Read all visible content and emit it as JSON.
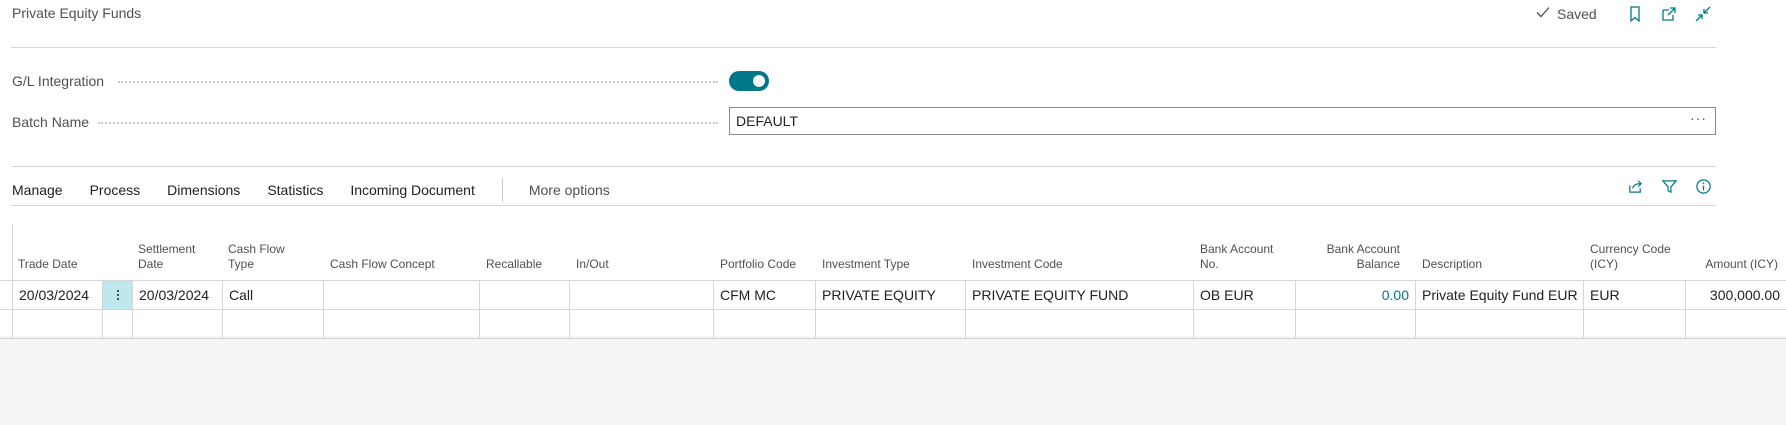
{
  "header": {
    "title": "Private Equity Funds",
    "status": "Saved",
    "icons": [
      "checkmark-icon",
      "bookmark-icon",
      "open-in-new-window-icon",
      "collapse-icon"
    ]
  },
  "fields": {
    "gl_integration": {
      "label": "G/L Integration",
      "value": true
    },
    "batch_name": {
      "label": "Batch Name",
      "value": "DEFAULT",
      "lookup": "···"
    }
  },
  "actions": {
    "items": [
      "Manage",
      "Process",
      "Dimensions",
      "Statistics",
      "Incoming Document"
    ],
    "more": "More options",
    "icons": [
      "share-icon",
      "filter-icon",
      "info-icon"
    ]
  },
  "table": {
    "columns": [
      "Trade Date",
      "Settlement Date",
      "Cash Flow Type",
      "Cash Flow Concept",
      "Recallable",
      "In/Out",
      "Portfolio Code",
      "Investment Type",
      "Investment Code",
      "Bank Account No.",
      "Bank Account Balance",
      "Description",
      "Currency Code (ICY)",
      "Amount (ICY)"
    ],
    "column_lines": {
      "settlement_date": [
        "Settlement",
        "Date"
      ],
      "cash_flow_type": [
        "Cash Flow",
        "Type"
      ],
      "bank_account_no": [
        "Bank Account",
        "No."
      ],
      "bank_account_balance": [
        "Bank Account",
        "Balance"
      ],
      "currency_code": [
        "Currency Code",
        "(ICY)"
      ]
    },
    "rows": [
      {
        "trade_date": "20/03/2024",
        "settlement_date": "20/03/2024",
        "cash_flow_type": "Call",
        "cash_flow_concept": "",
        "recallable": "",
        "in_out": "",
        "portfolio_code": "CFM MC",
        "investment_type": "PRIVATE EQUITY",
        "investment_code": "PRIVATE EQUITY FUND",
        "bank_account_no": "OB EUR",
        "bank_account_balance": "0.00",
        "description": "Private Equity Fund EUR",
        "currency_code": "EUR",
        "amount": "300,000.00"
      }
    ]
  },
  "colors": {
    "accent": "#00788a",
    "selection": "#bde8ed"
  }
}
